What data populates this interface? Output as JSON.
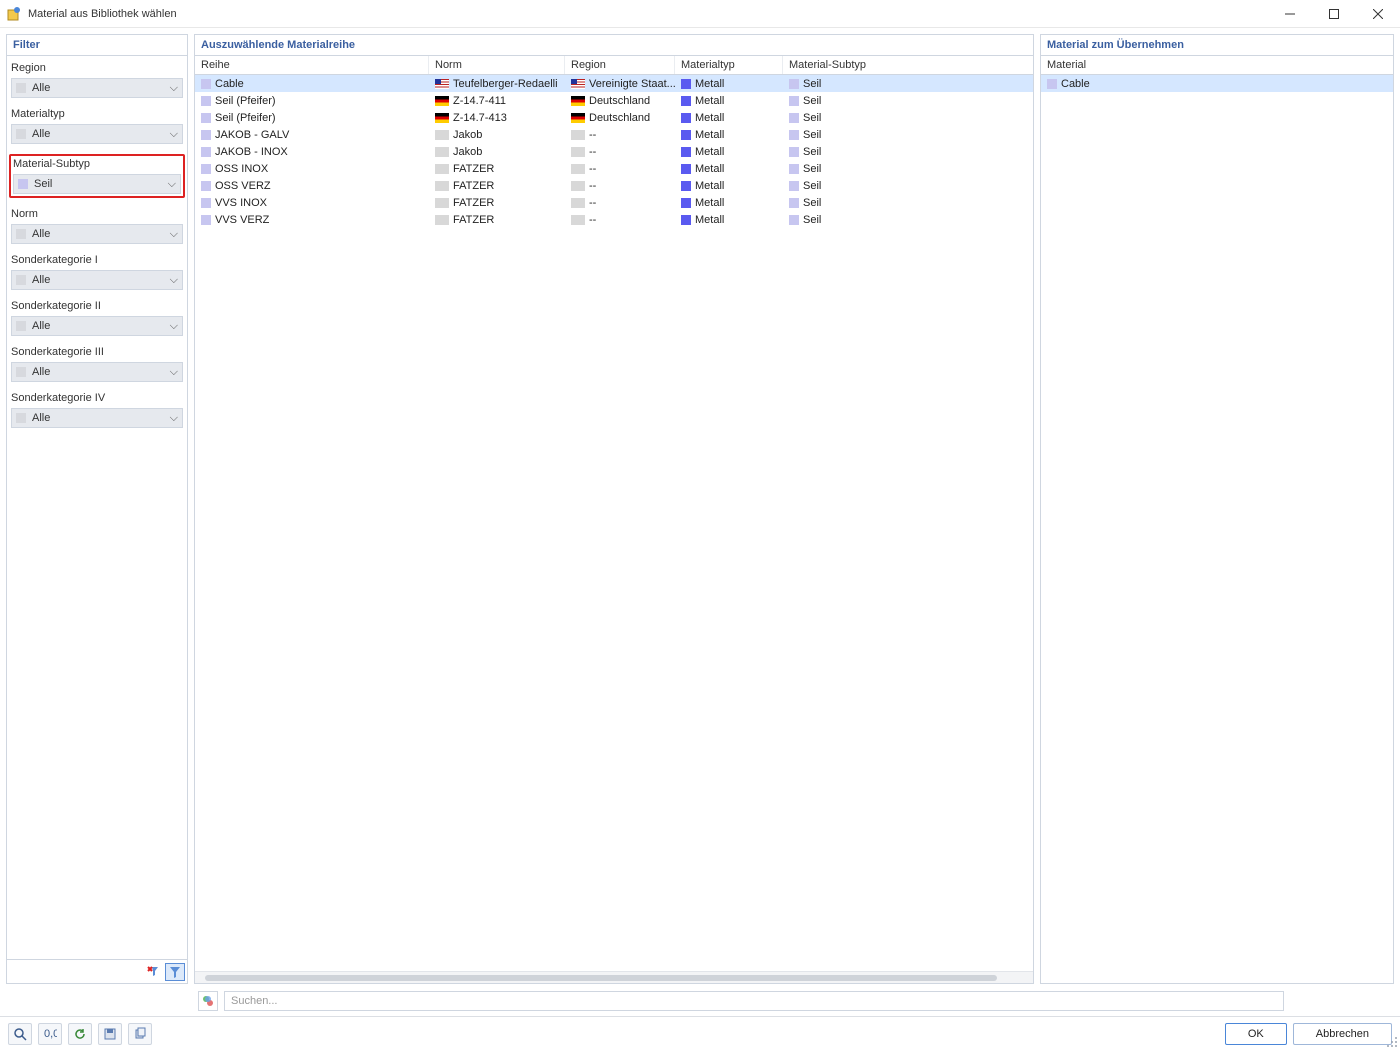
{
  "window": {
    "title": "Material aus Bibliothek wählen"
  },
  "filter": {
    "header": "Filter",
    "region": {
      "label": "Region",
      "value": "Alle"
    },
    "materialtyp": {
      "label": "Materialtyp",
      "value": "Alle"
    },
    "materialsubtyp": {
      "label": "Material-Subtyp",
      "value": "Seil",
      "highlight": true
    },
    "norm": {
      "label": "Norm",
      "value": "Alle"
    },
    "sk1": {
      "label": "Sonderkategorie I",
      "value": "Alle"
    },
    "sk2": {
      "label": "Sonderkategorie II",
      "value": "Alle"
    },
    "sk3": {
      "label": "Sonderkategorie III",
      "value": "Alle"
    },
    "sk4": {
      "label": "Sonderkategorie IV",
      "value": "Alle"
    }
  },
  "midpanel": {
    "header": "Auszuwählende Materialreihe",
    "columns": {
      "reihe": "Reihe",
      "norm": "Norm",
      "region": "Region",
      "mtyp": "Materialtyp",
      "subtyp": "Material-Subtyp"
    },
    "rows": [
      {
        "reihe": "Cable",
        "norm": "Teufelberger-Redaelli",
        "region": "Vereinigte Staat...",
        "flag": "us",
        "normflag": "us",
        "mtyp": "Metall",
        "subtyp": "Seil",
        "selected": true
      },
      {
        "reihe": "Seil (Pfeifer)",
        "norm": "Z-14.7-411",
        "region": "Deutschland",
        "flag": "de",
        "normflag": "de",
        "mtyp": "Metall",
        "subtyp": "Seil"
      },
      {
        "reihe": "Seil (Pfeifer)",
        "norm": "Z-14.7-413",
        "region": "Deutschland",
        "flag": "de",
        "normflag": "de",
        "mtyp": "Metall",
        "subtyp": "Seil"
      },
      {
        "reihe": "JAKOB - GALV",
        "norm": "Jakob",
        "region": "--",
        "flag": "none",
        "normflag": "none",
        "mtyp": "Metall",
        "subtyp": "Seil"
      },
      {
        "reihe": "JAKOB - INOX",
        "norm": "Jakob",
        "region": "--",
        "flag": "none",
        "normflag": "none",
        "mtyp": "Metall",
        "subtyp": "Seil"
      },
      {
        "reihe": "OSS INOX",
        "norm": "FATZER",
        "region": "--",
        "flag": "none",
        "normflag": "none",
        "mtyp": "Metall",
        "subtyp": "Seil"
      },
      {
        "reihe": "OSS VERZ",
        "norm": "FATZER",
        "region": "--",
        "flag": "none",
        "normflag": "none",
        "mtyp": "Metall",
        "subtyp": "Seil"
      },
      {
        "reihe": "VVS INOX",
        "norm": "FATZER",
        "region": "--",
        "flag": "none",
        "normflag": "none",
        "mtyp": "Metall",
        "subtyp": "Seil"
      },
      {
        "reihe": "VVS VERZ",
        "norm": "FATZER",
        "region": "--",
        "flag": "none",
        "normflag": "none",
        "mtyp": "Metall",
        "subtyp": "Seil"
      }
    ]
  },
  "rightpanel": {
    "header": "Material zum Übernehmen",
    "column": "Material",
    "rows": [
      {
        "name": "Cable",
        "selected": true
      }
    ]
  },
  "search": {
    "placeholder": "Suchen..."
  },
  "footer": {
    "ok": "OK",
    "cancel": "Abbrechen"
  }
}
